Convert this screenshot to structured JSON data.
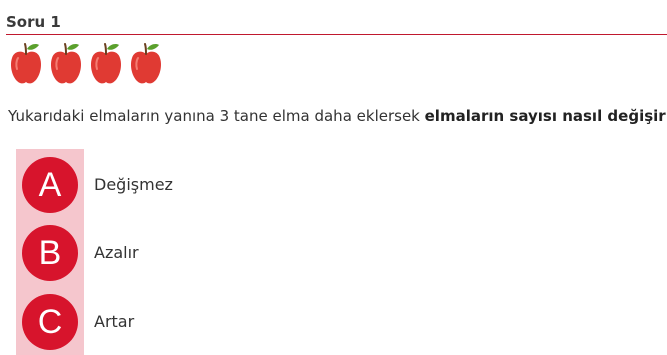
{
  "header": {
    "title": "Soru 1"
  },
  "apples": {
    "count": 4,
    "icon": "apple-icon",
    "color": "#e03a33"
  },
  "question": {
    "text_plain": "Yukarıdaki elmaların yanına 3 tane elma daha eklersek ",
    "text_bold": "elmaların sayısı nasıl değişir ?"
  },
  "options": [
    {
      "letter": "A",
      "label": "Değişmez"
    },
    {
      "letter": "B",
      "label": "Azalır"
    },
    {
      "letter": "C",
      "label": "Artar"
    }
  ],
  "colors": {
    "accent": "#d7142c",
    "strip": "#f5c6cd",
    "divider": "#c0182e"
  }
}
